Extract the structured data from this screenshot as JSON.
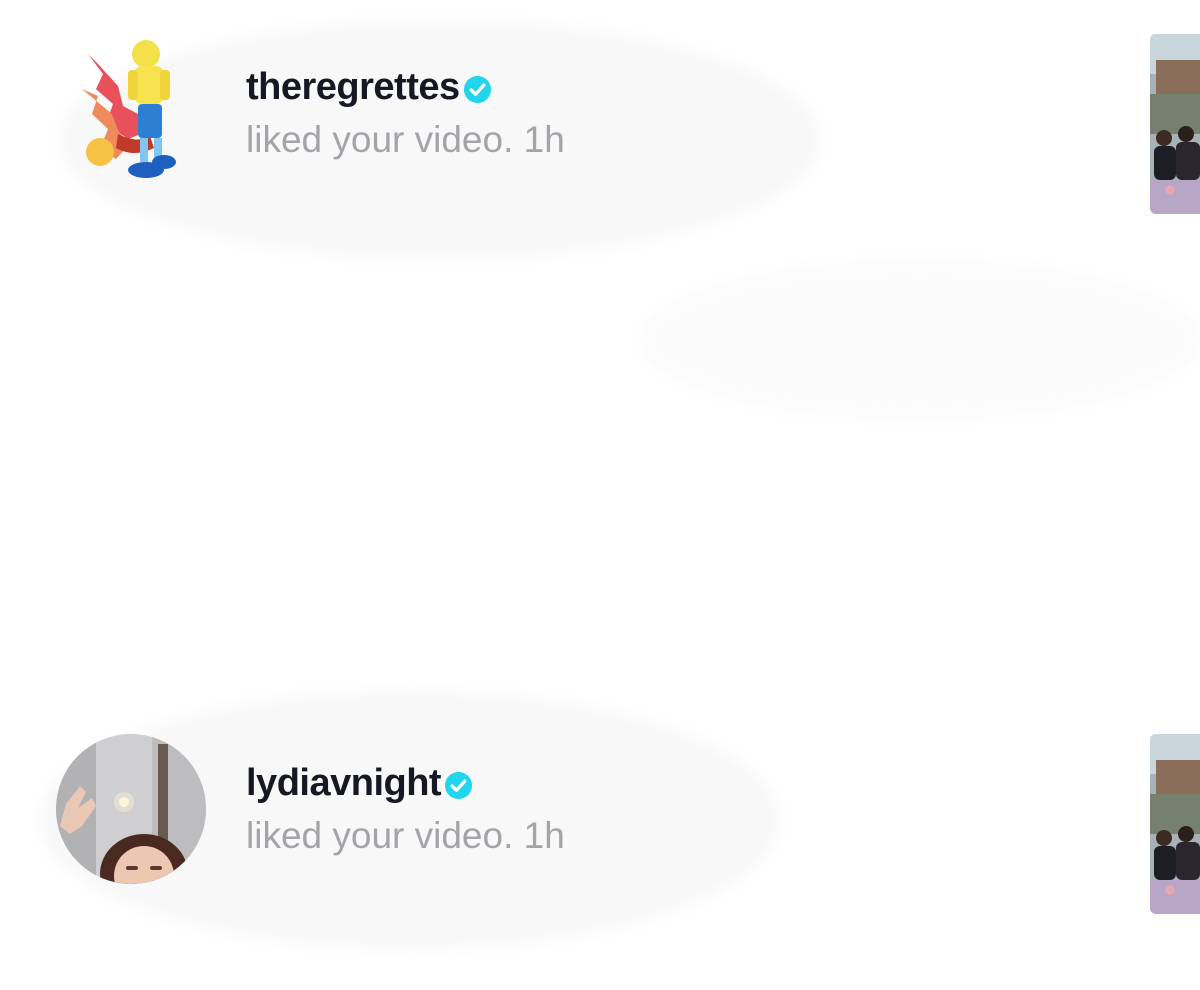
{
  "notifications": [
    {
      "username": "theregrettes",
      "verified": true,
      "action": "liked your video.",
      "time": "1h",
      "avatar_icon": "cartoon-characters-avatar"
    },
    {
      "username": "lydiavnight",
      "verified": true,
      "action": "liked your video.",
      "time": "1h",
      "avatar_icon": "selfie-photo-avatar"
    }
  ],
  "colors": {
    "username": "#161823",
    "secondary_text": "#a3a4a8",
    "verified_badge": "#20d5ec"
  }
}
